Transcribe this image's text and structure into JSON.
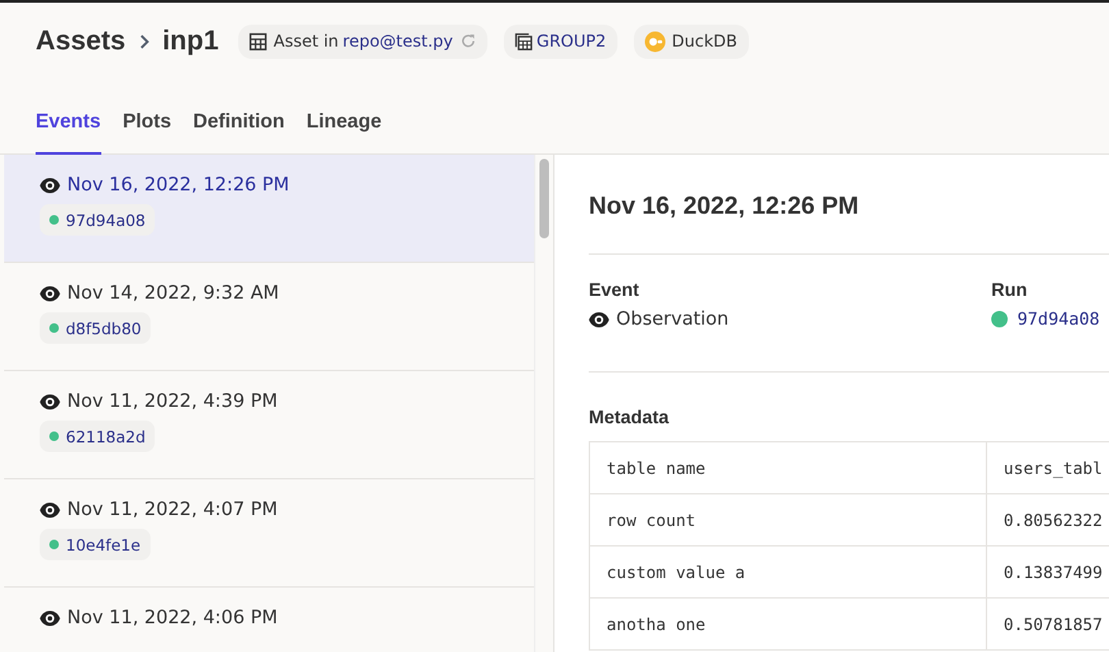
{
  "breadcrumb": {
    "root": "Assets",
    "current": "inp1"
  },
  "tags": [
    {
      "kind": "definition",
      "prefix": "Asset in",
      "link": "repo@test.py"
    },
    {
      "kind": "group",
      "label": "GROUP2"
    },
    {
      "kind": "compute",
      "label": "DuckDB"
    }
  ],
  "tabs": [
    {
      "label": "Events",
      "selected": true
    },
    {
      "label": "Plots",
      "selected": false
    },
    {
      "label": "Definition",
      "selected": false
    },
    {
      "label": "Lineage",
      "selected": false
    }
  ],
  "events": [
    {
      "time": "Nov 16, 2022, 12:26 PM",
      "run": "97d94a08",
      "selected": true
    },
    {
      "time": "Nov 14, 2022, 9:32 AM",
      "run": "d8f5db80",
      "selected": false
    },
    {
      "time": "Nov 11, 2022, 4:39 PM",
      "run": "62118a2d",
      "selected": false
    },
    {
      "time": "Nov 11, 2022, 4:07 PM",
      "run": "10e4fe1e",
      "selected": false
    },
    {
      "time": "Nov 11, 2022, 4:06 PM",
      "selected": false
    }
  ],
  "detail": {
    "title": "Nov 16, 2022, 12:26 PM",
    "event_label": "Event",
    "event_value": "Observation",
    "run_label": "Run",
    "run_value": "97d94a08",
    "metadata_label": "Metadata",
    "metadata": [
      {
        "key": "table name",
        "value": "users_tabl"
      },
      {
        "key": "row count",
        "value": "0.80562322"
      },
      {
        "key": "custom value a",
        "value": "0.13837499"
      },
      {
        "key": "anotha one",
        "value": "0.50781857"
      }
    ]
  }
}
